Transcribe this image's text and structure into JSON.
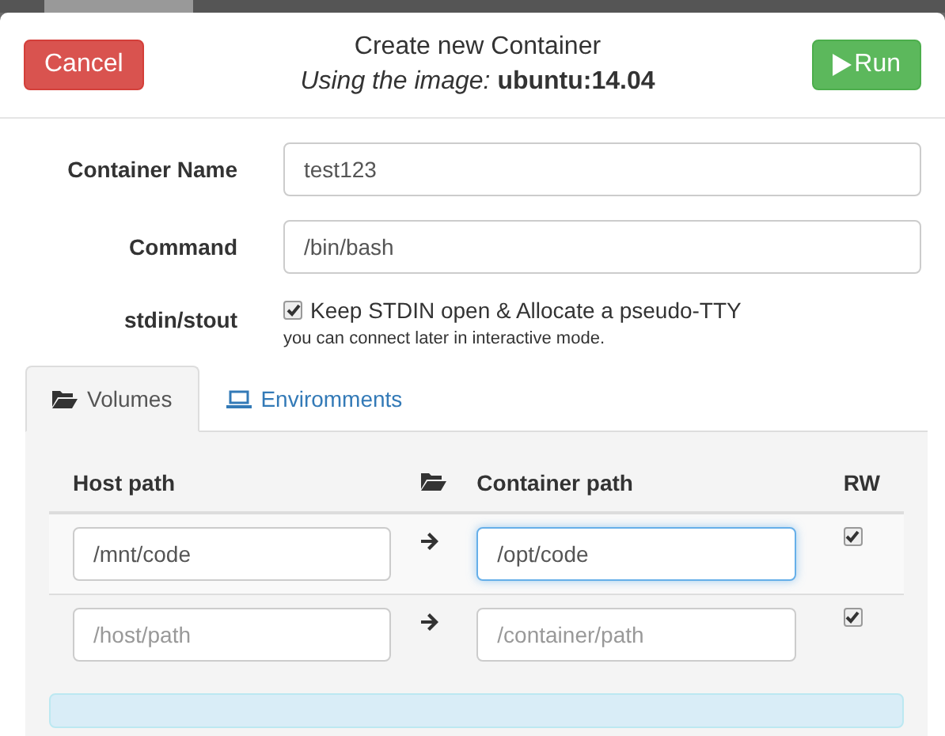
{
  "header": {
    "cancel": "Cancel",
    "title": "Create new Container",
    "subtitle_prefix": "Using the image:",
    "image": "ubuntu:14.04",
    "run": "Run"
  },
  "form": {
    "fields": [
      {
        "label": "Container Name",
        "value": "test123"
      },
      {
        "label": "Command",
        "value": "/bin/bash"
      }
    ],
    "stdin": {
      "label": "stdin/stout",
      "checkbox_label": "Keep STDIN open & Allocate a pseudo-TTY",
      "checked": true,
      "help": "you can connect later in interactive mode."
    }
  },
  "tabs": [
    {
      "label": "Volumes",
      "selected": true
    },
    {
      "label": "Enviromments",
      "selected": false
    }
  ],
  "volumes": {
    "columns": [
      "Host path",
      "Container path",
      "RW"
    ],
    "rows": [
      {
        "host": {
          "value": "/mnt/code"
        },
        "container": {
          "value": "/opt/code",
          "focused": true
        },
        "rw": true
      },
      {
        "host": {
          "placeholder": "/host/path"
        },
        "container": {
          "placeholder": "/container/path",
          "focused": false
        },
        "rw": true
      }
    ]
  }
}
